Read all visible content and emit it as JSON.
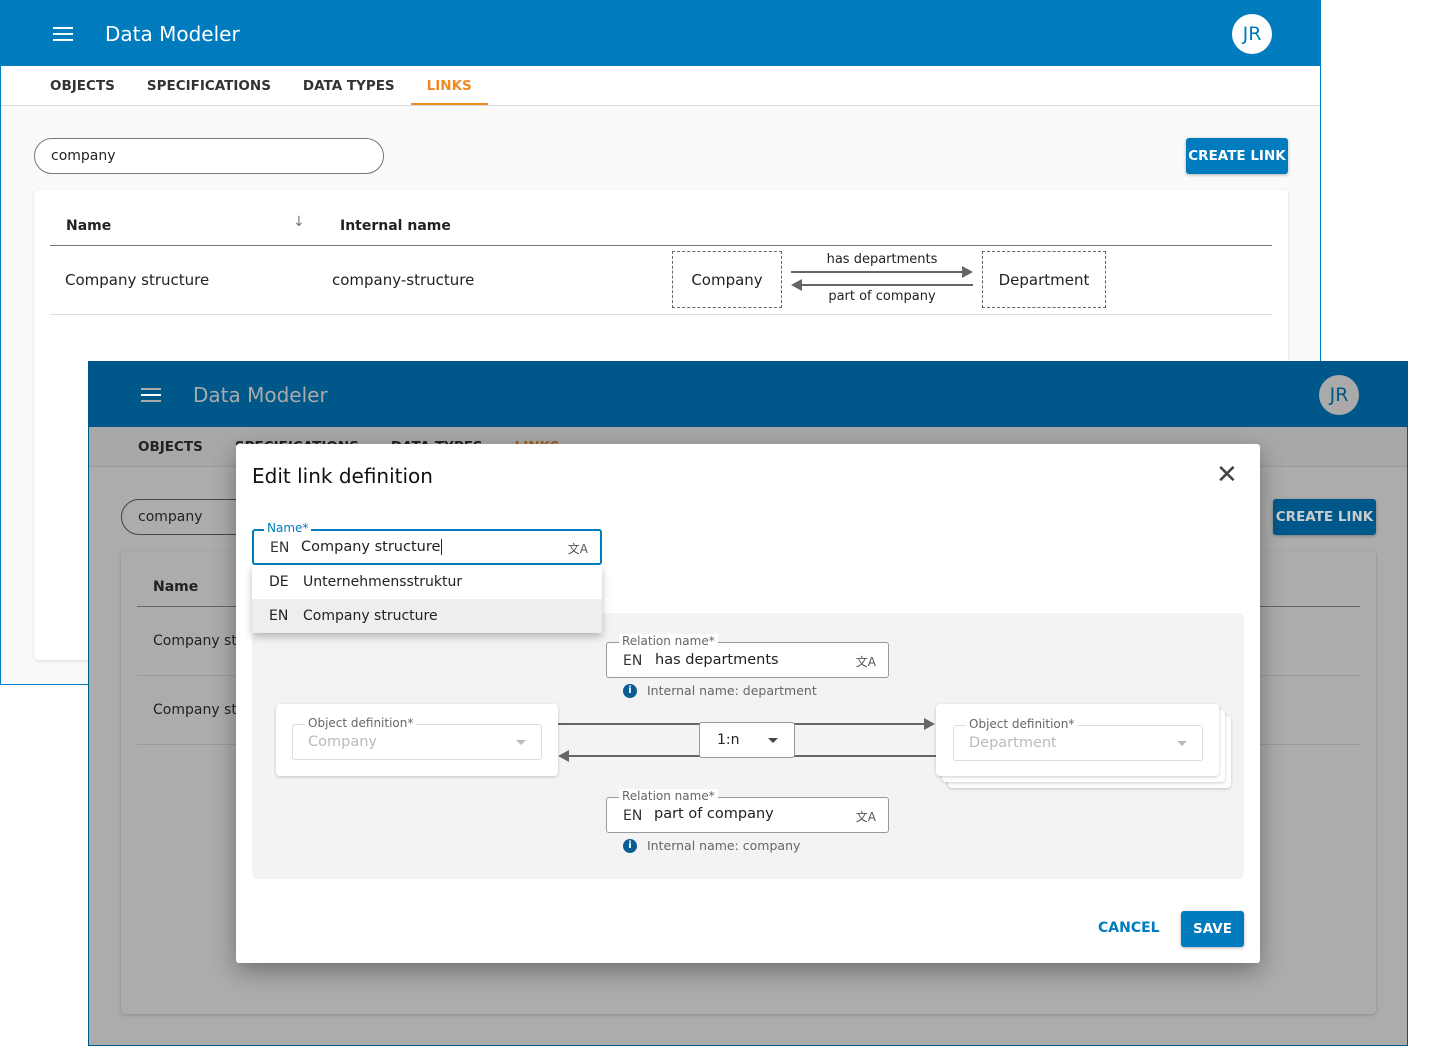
{
  "back": {
    "app_title": "Data Modeler",
    "avatar": "JR",
    "tabs": [
      "OBJECTS",
      "SPECIFICATIONS",
      "DATA TYPES",
      "LINKS"
    ],
    "active_tab": "LINKS",
    "search_value": "company",
    "create_link": "CREATE LINK",
    "table": {
      "columns": [
        "Name",
        "Internal name"
      ],
      "rows": [
        {
          "name": "Company structure",
          "internal": "company-structure",
          "source": "Company",
          "target": "Department",
          "forward": "has departments",
          "backward": "part of company"
        }
      ]
    }
  },
  "front": {
    "app_title": "Data Modeler",
    "avatar": "JR",
    "tabs": [
      "OBJECTS",
      "SPECIFICATIONS",
      "DATA TYPES",
      "LINKS"
    ],
    "search_value": "company",
    "create_link": "CREATE LINK",
    "columns": [
      "Name"
    ],
    "rows": [
      "Company str",
      "Company str"
    ]
  },
  "dialog": {
    "title": "Edit link definition",
    "name_label": "Name",
    "name_lang": "EN",
    "name_value": "Company structure",
    "translations": [
      {
        "lang": "DE",
        "value": "Unternehmensstruktur"
      },
      {
        "lang": "EN",
        "value": "Company structure"
      }
    ],
    "relation_forward": {
      "label": "Relation name",
      "lang": "EN",
      "value": "has departments",
      "hint": "Internal name: department"
    },
    "relation_backward": {
      "label": "Relation name",
      "lang": "EN",
      "value": "part of company",
      "hint": "Internal name: company"
    },
    "source": {
      "label": "Object definition",
      "value": "Company"
    },
    "target": {
      "label": "Object definition",
      "value": "Department"
    },
    "cardinality": "1:n",
    "cancel": "CANCEL",
    "save": "SAVE",
    "required_mark": "*"
  },
  "colors": {
    "brand": "#007bbd",
    "accent": "#f08a24",
    "dim_header": "#00578a"
  }
}
